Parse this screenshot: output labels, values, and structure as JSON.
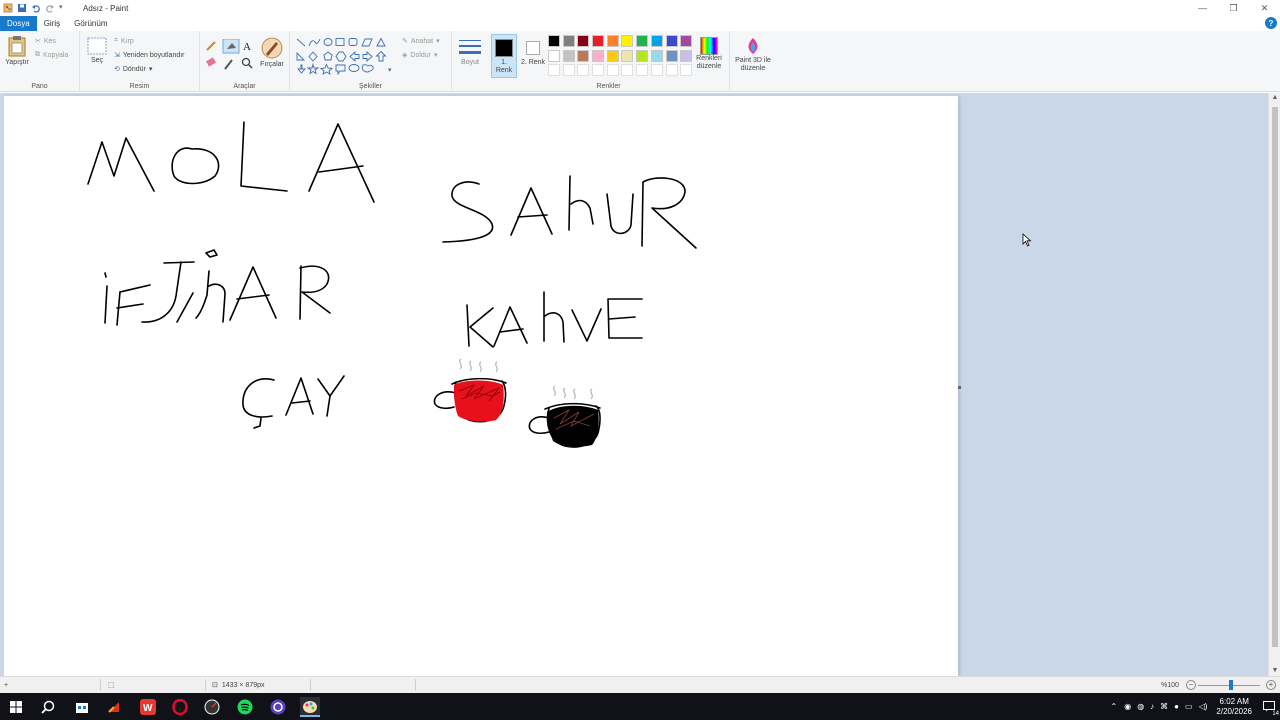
{
  "window": {
    "title": "Adsız - Paint"
  },
  "menu": {
    "tabs": [
      "Dosya",
      "Giriş",
      "Görünüm"
    ]
  },
  "ribbon": {
    "pano": {
      "label": "Pano",
      "paste": "Yapıştır",
      "cut": "Kes",
      "copy": "Kopyala"
    },
    "resim": {
      "label": "Resim",
      "select": "Seç",
      "crop": "Kırp",
      "resize": "Yeniden boyutlandır",
      "rotate": "Döndür"
    },
    "araclar": {
      "label": "Araçlar",
      "brushes": "Fırçalar"
    },
    "sekiller": {
      "label": "Şekiller",
      "outline": "Anahat",
      "fill": "Doldur"
    },
    "size": {
      "label": "Boyut"
    },
    "colors": {
      "label": "Renkler",
      "color1": "1. Renk",
      "color2": "2. Renk",
      "edit": "Renkleri düzenle",
      "paint3d": "Paint 3D ile düzenle",
      "color1_value": "#000000",
      "color2_value": "#ffffff",
      "palette_row1": [
        "#000000",
        "#7f7f7f",
        "#880015",
        "#ed1c24",
        "#ff7f27",
        "#fff200",
        "#22b14c",
        "#00a2e8",
        "#3f48cc",
        "#a349a4"
      ],
      "palette_row2": [
        "#ffffff",
        "#c3c3c3",
        "#b97a57",
        "#ffaec9",
        "#ffc90e",
        "#efe4b0",
        "#b5e61d",
        "#99d9ea",
        "#7092be",
        "#c8bfe7"
      ],
      "palette_row3": [
        "#ffffff",
        "#ffffff",
        "#ffffff",
        "#ffffff",
        "#ffffff",
        "#ffffff",
        "#ffffff",
        "#ffffff",
        "#ffffff",
        "#ffffff"
      ]
    }
  },
  "canvas_drawing": {
    "words": [
      "MOLA",
      "SAHUR",
      "İFTAR",
      "KAHVE",
      "ÇAY"
    ],
    "cups": [
      {
        "fill": "#e8111b"
      },
      {
        "fill": "#000000"
      }
    ]
  },
  "statusbar": {
    "dimensions": "1433 × 879px",
    "zoom": "%100"
  },
  "taskbar": {
    "time": "6:02 AM",
    "date": "2/20/2026",
    "notifications": "14"
  }
}
